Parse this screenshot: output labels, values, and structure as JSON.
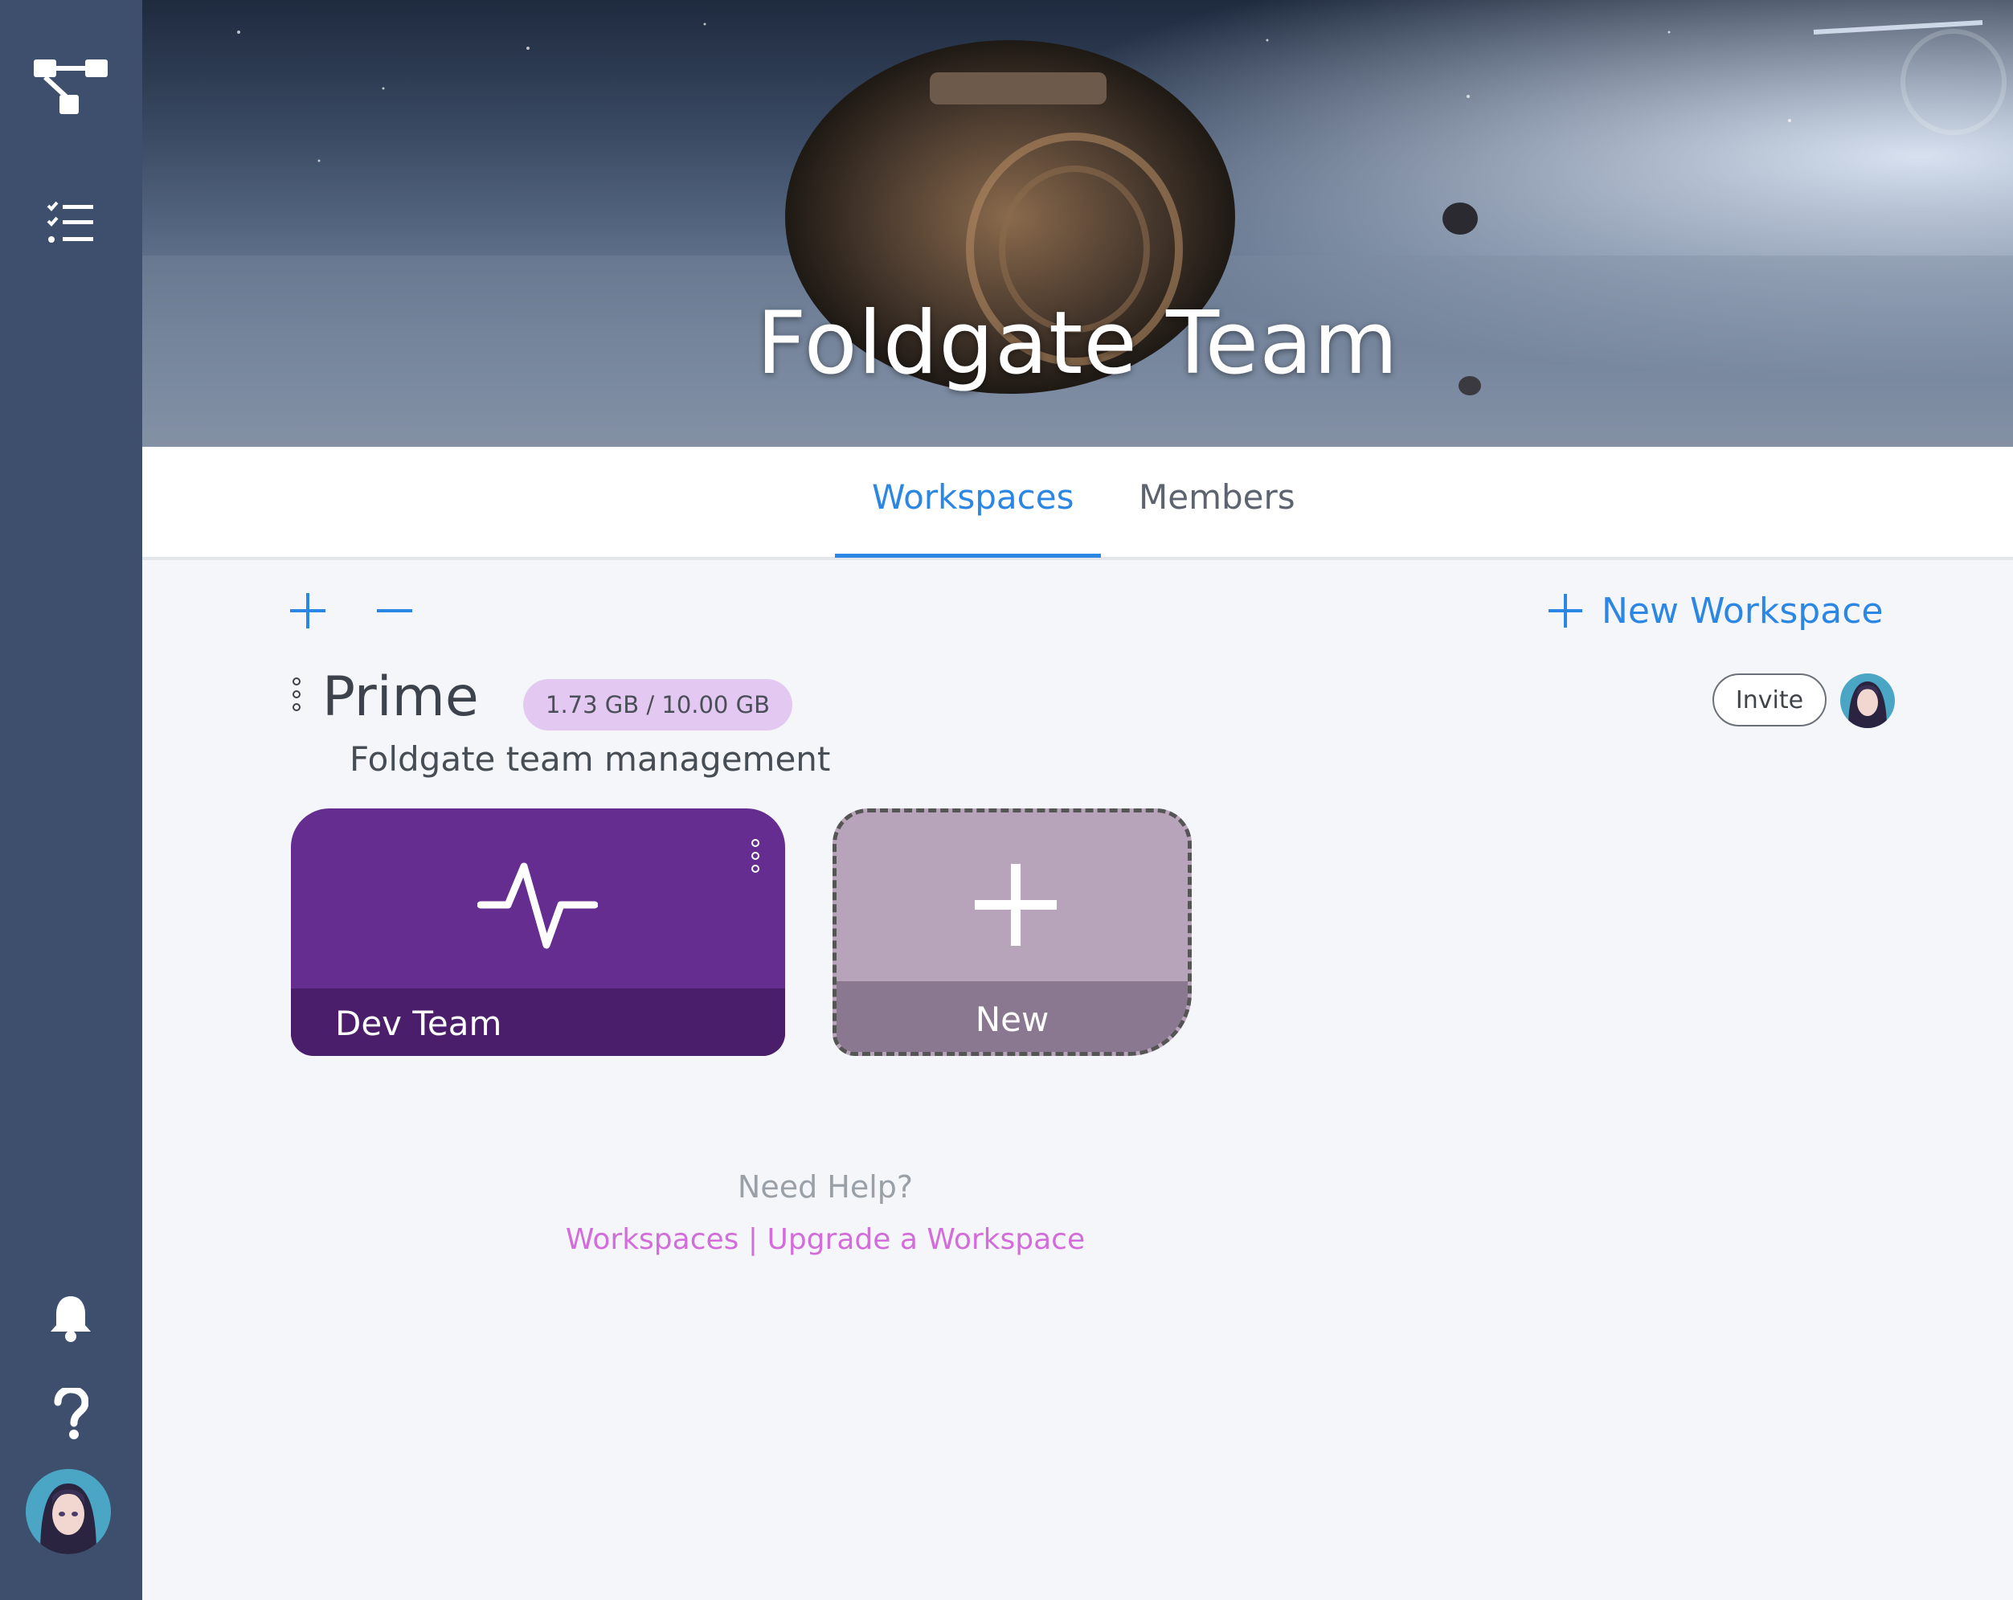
{
  "sidebar": {
    "icons": [
      "workflow-icon",
      "checklist-icon",
      "bell-icon",
      "help-icon"
    ],
    "avatar": "user-avatar"
  },
  "banner": {
    "title": "Foldgate Team"
  },
  "tabs": [
    {
      "label": "Workspaces",
      "active": true
    },
    {
      "label": "Members",
      "active": false
    }
  ],
  "toolbar": {
    "new_workspace_label": "New Workspace"
  },
  "group": {
    "name": "Prime",
    "storage": "1.73 GB / 10.00 GB",
    "description": "Foldgate team management",
    "invite_label": "Invite"
  },
  "cards": [
    {
      "label": "Dev Team",
      "icon": "activity-icon",
      "color": "#662d91"
    },
    {
      "label": "New",
      "icon": "plus-icon",
      "color": "#b8a4ba"
    }
  ],
  "help": {
    "title": "Need Help?",
    "link1": "Workspaces",
    "separator": "|",
    "link2": "Upgrade a Workspace"
  },
  "colors": {
    "sidebar": "#3d4f6c",
    "accent": "#2b87e3",
    "link": "#d36ddb"
  }
}
